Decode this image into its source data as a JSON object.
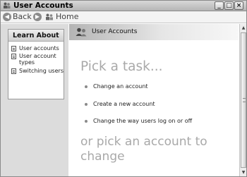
{
  "window": {
    "title": "User Accounts",
    "controls": {
      "minimize": "_",
      "maximize": "□",
      "close": "×"
    }
  },
  "toolbar": {
    "back_label": "Back",
    "home_label": "Home",
    "back_icon": "back-arrow-icon",
    "forward_icon": "forward-arrow-icon",
    "home_icon": "home-icon"
  },
  "sidebar": {
    "heading": "Learn About",
    "items": [
      {
        "label": "User accounts",
        "icon": "document-icon"
      },
      {
        "label": "User account types",
        "icon": "document-icon"
      },
      {
        "label": "Switching users",
        "icon": "document-icon"
      }
    ]
  },
  "main": {
    "banner_title": "User Accounts",
    "banner_icon": "users-icon",
    "pick_heading": "Pick a task...",
    "tasks": [
      {
        "label": "Change an account"
      },
      {
        "label": "Create a new account"
      },
      {
        "label": "Change the way users log on or off"
      }
    ],
    "or_heading": "or pick an account to change"
  },
  "colors": {
    "heading_gray": "#a9a9a9",
    "panel_gray": "#dcdcdc",
    "titlebar": "#c6c6c6"
  }
}
